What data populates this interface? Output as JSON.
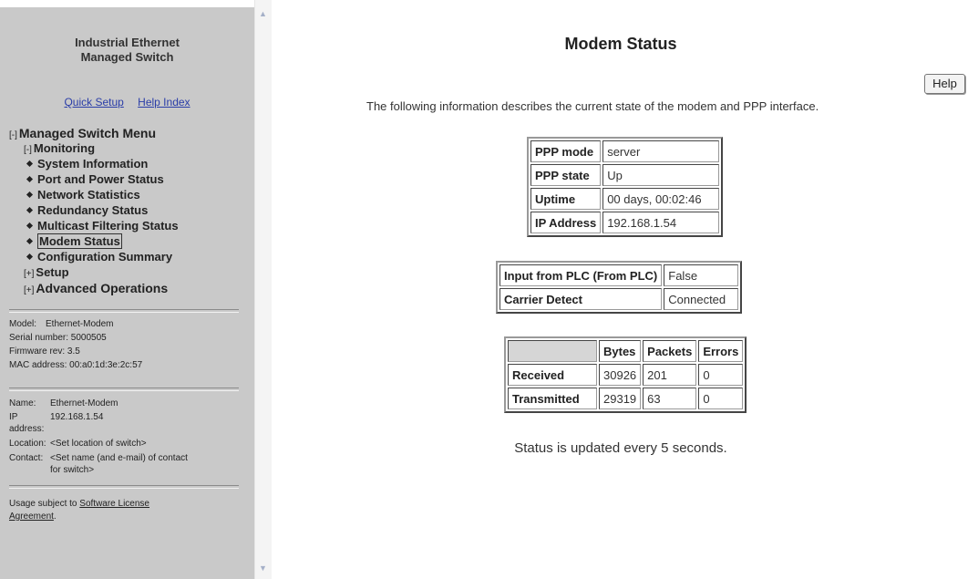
{
  "sidebar": {
    "title_line1": "Industrial Ethernet",
    "title_line2": "Managed Switch",
    "quick_setup": "Quick Setup",
    "help_index": "Help Index",
    "menu": {
      "root_toggle": "[-]",
      "root": "Managed Switch Menu",
      "monitoring_toggle": "[-]",
      "monitoring": "Monitoring",
      "items": [
        "System Information",
        "Port and Power Status",
        "Network Statistics",
        "Redundancy Status",
        "Multicast Filtering Status",
        "Modem Status",
        "Configuration Summary"
      ],
      "setup_toggle": "[+]",
      "setup": "Setup",
      "advanced_toggle": "[+]",
      "advanced": "Advanced Operations"
    },
    "device": {
      "model_label": "Model:",
      "model": "Ethernet-Modem",
      "serial": "Serial number: 5000505",
      "firmware": "Firmware rev: 3.5",
      "mac": "MAC address: 00:a0:1d:3e:2c:57"
    },
    "identity": {
      "name_label": "Name:",
      "name": "Ethernet-Modem",
      "ip_label_1": "IP",
      "ip_label_2": "address:",
      "ip": "192.168.1.54",
      "location_label": "Location:",
      "location": "<Set location of switch>",
      "contact_label": "Contact:",
      "contact_1": "<Set name (and e-mail) of contact",
      "contact_2": "for switch>"
    },
    "usage_text": "Usage subject to",
    "license_link_1": "Software License",
    "license_link_2": "Agreement",
    "usage_end": "."
  },
  "main": {
    "title": "Modem Status",
    "help_button": "Help",
    "intro": "The following information describes the current state of the modem and PPP interface.",
    "ppp_table": [
      {
        "label": "PPP mode",
        "value": "server"
      },
      {
        "label": "PPP state",
        "value": "Up"
      },
      {
        "label": "Uptime",
        "value": "00 days, 00:02:46"
      },
      {
        "label": "IP Address",
        "value": "192.168.1.54"
      }
    ],
    "plc_table": [
      {
        "label": "Input from PLC (From PLC)",
        "value": "False"
      },
      {
        "label": "Carrier Detect",
        "value": "Connected"
      }
    ],
    "traffic_table": {
      "headers": [
        "Bytes",
        "Packets",
        "Errors"
      ],
      "rows": [
        {
          "label": "Received",
          "bytes": "30926",
          "packets": "201",
          "errors": "0"
        },
        {
          "label": "Transmitted",
          "bytes": "29319",
          "packets": "63",
          "errors": "0"
        }
      ]
    },
    "footer_note": "Status is updated every 5 seconds."
  },
  "scrollbar": {
    "up_icon": "▲",
    "down_icon": "▼"
  }
}
